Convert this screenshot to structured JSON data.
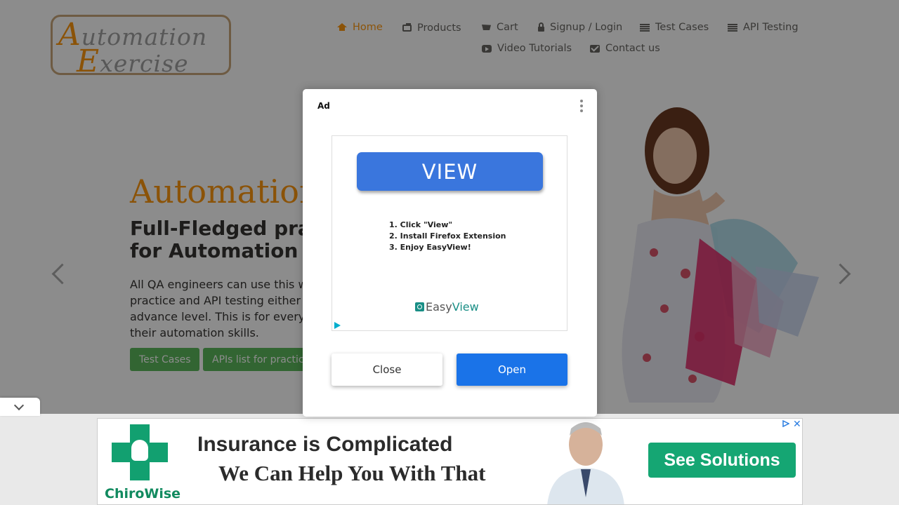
{
  "logo": {
    "line1_cap": "A",
    "line1_rest": "utomation",
    "line2_cap": "E",
    "line2_rest": "xercise"
  },
  "nav": {
    "items": [
      {
        "label": "Home",
        "icon": "home-icon",
        "active": true
      },
      {
        "label": "Products",
        "icon": "briefcase-icon"
      },
      {
        "label": "Cart",
        "icon": "cart-icon"
      },
      {
        "label": "Signup / Login",
        "icon": "lock-icon"
      },
      {
        "label": "Test Cases",
        "icon": "list-icon"
      },
      {
        "label": "API Testing",
        "icon": "list-icon"
      },
      {
        "label": "Video Tutorials",
        "icon": "youtube-icon"
      },
      {
        "label": "Contact us",
        "icon": "envelope-icon"
      }
    ]
  },
  "hero": {
    "title": "Automation",
    "subtitle_line1": "Full-Fledged pra",
    "subtitle_line2": "for Automation",
    "desc_lines": [
      "All QA engineers can use this w",
      "practice and API testing either",
      "advance level. This is for every",
      "their automation skills."
    ],
    "buttons": [
      "Test Cases",
      "APIs list for practic"
    ]
  },
  "modal": {
    "ad_label": "Ad",
    "view_label": "VIEW",
    "steps": [
      "1. Click \"View\"",
      "2. Install Firefox Extension",
      "3. Enjoy EasyView!"
    ],
    "brand_part1": "Easy",
    "brand_part2": "View",
    "close_label": "Close",
    "open_label": "Open"
  },
  "banner": {
    "brand": "ChiroWise",
    "headline": "Insurance is Complicated",
    "subline": "We Can Help You With That",
    "cta": "See Solutions",
    "close_symbol": "✕"
  },
  "colors": {
    "accent": "#fe980f",
    "button_green": "#5cb85c",
    "open_blue": "#1a73e8",
    "view_blue": "#3a76dd",
    "banner_green": "#15a673"
  }
}
